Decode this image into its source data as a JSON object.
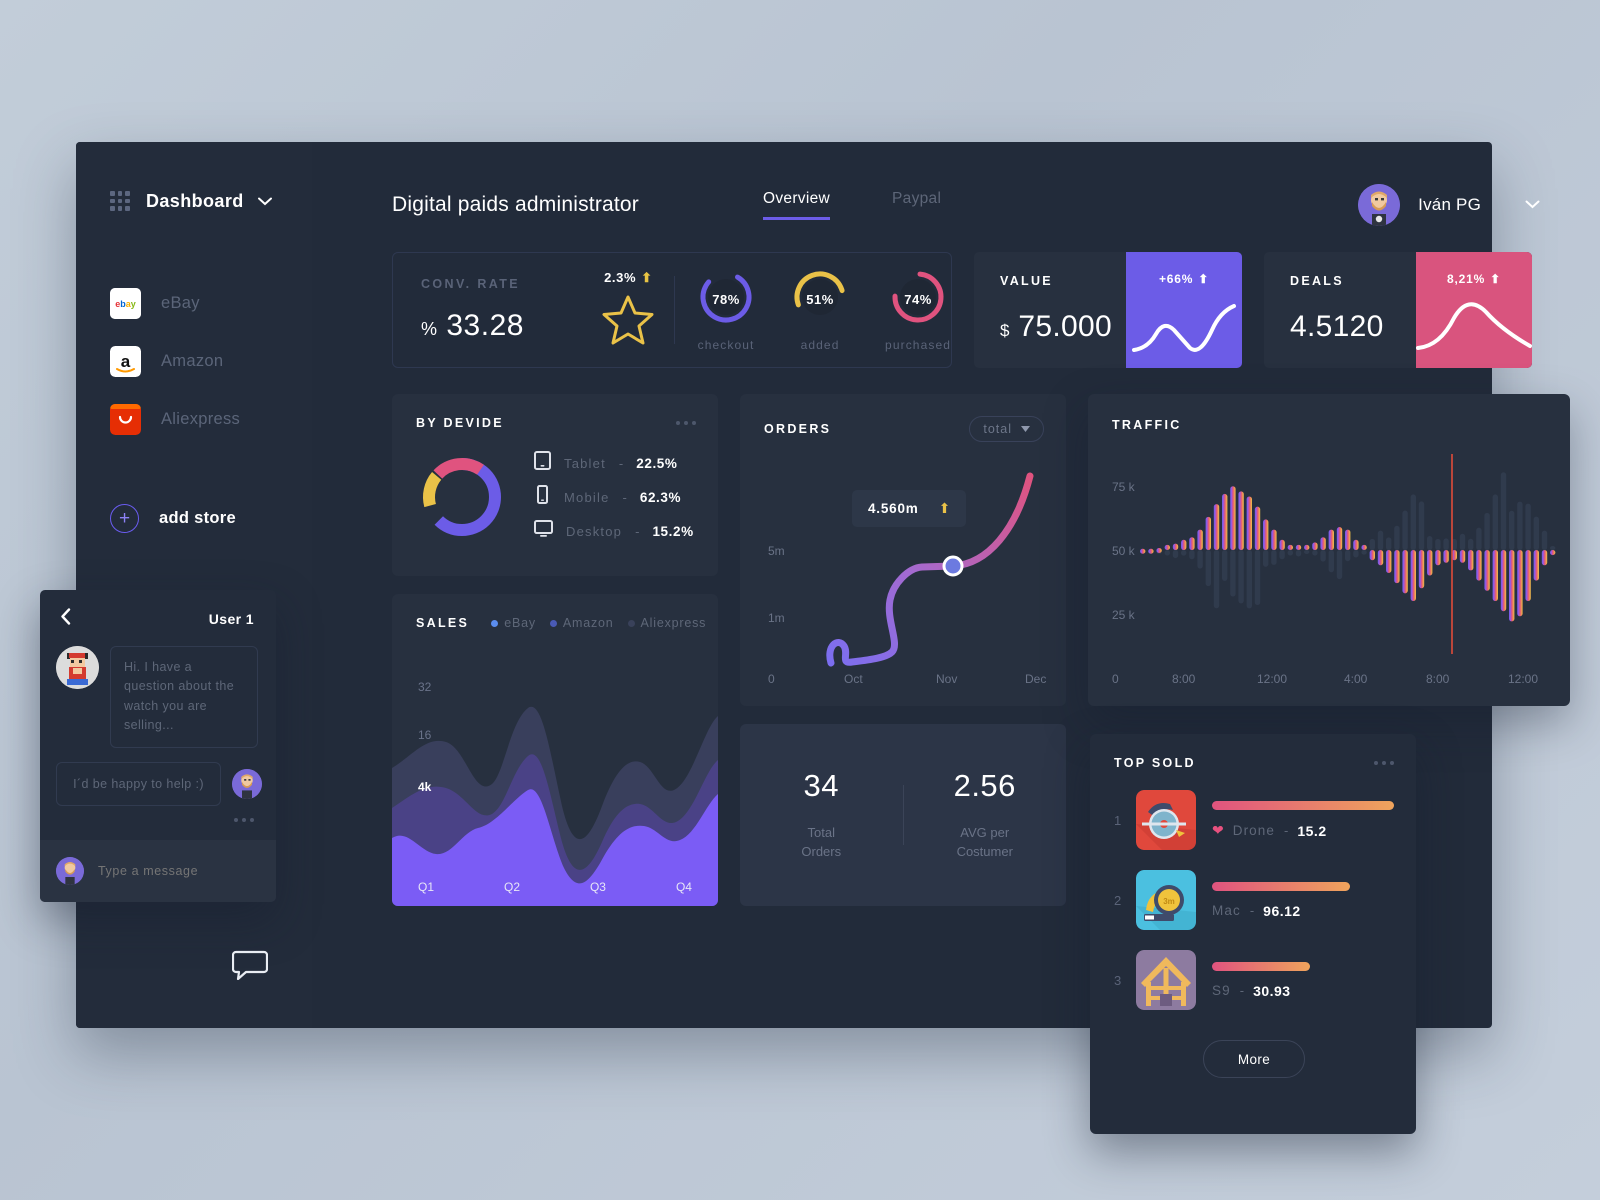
{
  "sidebar": {
    "dashboard_label": "Dashboard",
    "stores": [
      {
        "label": "eBay",
        "icon": "ebay-logo"
      },
      {
        "label": "Amazon",
        "icon": "amazon-logo"
      },
      {
        "label": "Aliexpress",
        "icon": "aliexpress-logo"
      }
    ],
    "add_store_label": "add store"
  },
  "header": {
    "title": "Digital paids administrator",
    "tabs": [
      {
        "label": "Overview",
        "active": true
      },
      {
        "label": "Paypal",
        "active": false
      }
    ],
    "user_name": "Iván PG"
  },
  "conv_card": {
    "label": "CONV. RATE",
    "currency": "%",
    "value": "33.28",
    "delta": "2.3%",
    "delta_dir": "up",
    "rings": [
      {
        "caption": "checkout",
        "pct": "78%",
        "value": 78,
        "color": "#6c5ce7"
      },
      {
        "caption": "added",
        "pct": "51%",
        "value": 51,
        "color": "#eac248"
      },
      {
        "caption": "purchased",
        "pct": "74%",
        "value": 74,
        "color": "#e0537f"
      }
    ]
  },
  "kpis": [
    {
      "label": "VALUE",
      "currency": "$",
      "value": "75.000",
      "badge": "+66%",
      "badge_dir": "up",
      "color": "#6c5ce7"
    },
    {
      "label": "DEALS",
      "currency": "",
      "value": "4.5120",
      "badge": "8,21%",
      "badge_dir": "up",
      "color": "#d9547e"
    }
  ],
  "by_device": {
    "title": "BY DEVIDE",
    "rows": [
      {
        "icon": "tablet-icon",
        "name": "Tablet",
        "value": "22.5%"
      },
      {
        "icon": "mobile-icon",
        "name": "Mobile",
        "value": "62.3%"
      },
      {
        "icon": "desktop-icon",
        "name": "Desktop",
        "value": "15.2%"
      }
    ]
  },
  "sales": {
    "title": "SALES",
    "legend": [
      {
        "label": "eBay",
        "color": "#5b8def"
      },
      {
        "label": "Amazon",
        "color": "#4a5ab5"
      },
      {
        "label": "Aliexpress",
        "color": "#39415a"
      }
    ],
    "y_labels": [
      "32",
      "16",
      "4k"
    ],
    "x_labels": [
      "Q1",
      "Q2",
      "Q3",
      "Q4"
    ]
  },
  "orders": {
    "title": "ORDERS",
    "selector": "total",
    "tooltip_value": "4.560m",
    "tooltip_dir": "up",
    "y_labels": [
      "5m",
      "1m",
      "0"
    ],
    "x_labels": [
      "Oct",
      "Nov",
      "Dec"
    ],
    "stats": [
      {
        "value": "34",
        "label": "Total Orders",
        "line1": "Total",
        "line2": "Orders"
      },
      {
        "value": "2.56",
        "label": "AVG per Costumer",
        "line1": "AVG per",
        "line2": "Costumer"
      }
    ]
  },
  "traffic": {
    "title": "TRAFFIC",
    "y_labels": [
      "75 k",
      "50 k",
      "25 k",
      "0"
    ],
    "x_labels": [
      "8:00",
      "12:00",
      "4:00",
      "8:00",
      "12:00"
    ]
  },
  "top_sold": {
    "title": "TOP SOLD",
    "items": [
      {
        "rank": "1",
        "name": "Drone",
        "value": "15.2",
        "bar": 100,
        "thumb": "circular-saw",
        "liked": true
      },
      {
        "rank": "2",
        "name": "Mac",
        "value": "96.12",
        "bar": 76,
        "thumb": "tape-measure",
        "liked": false
      },
      {
        "rank": "3",
        "name": "S9",
        "value": "30.93",
        "bar": 54,
        "thumb": "house-frame",
        "liked": false
      }
    ],
    "more_label": "More"
  },
  "chat": {
    "user": "User 1",
    "messages": [
      {
        "from": "them",
        "text": "Hi. I have a question about the watch you are selling..."
      },
      {
        "from": "me",
        "text": "I´d be happy to help :)"
      }
    ],
    "input_placeholder": "Type a message"
  },
  "chart_data": [
    {
      "type": "pie",
      "title": "BY DEVIDE",
      "categories": [
        "Mobile",
        "Tablet",
        "Desktop"
      ],
      "values": [
        62.3,
        22.5,
        15.2
      ],
      "colors": [
        "#6c5ce7",
        "#e0537f",
        "#eac248"
      ]
    },
    {
      "type": "area",
      "title": "SALES",
      "categories": [
        "Q1",
        "Q2",
        "Q3",
        "Q4"
      ],
      "ylabel": "",
      "xlabel": "",
      "ytick_labels": [
        "4k",
        "16",
        "32"
      ],
      "series": [
        {
          "name": "eBay",
          "color": "#7b5cf5",
          "values": [
            12,
            9,
            13,
            18,
            20,
            10,
            6,
            11,
            17,
            13,
            22,
            24
          ]
        },
        {
          "name": "Amazon",
          "color": "#4a4286",
          "values": [
            6,
            5,
            6,
            7,
            8,
            5,
            4,
            6,
            7,
            6,
            8,
            9
          ]
        },
        {
          "name": "Aliexpress",
          "color": "#393f5c",
          "values": [
            5,
            4,
            5,
            9,
            10,
            4,
            3,
            6,
            7,
            5,
            8,
            9
          ]
        }
      ]
    },
    {
      "type": "line",
      "title": "ORDERS",
      "x": [
        "0",
        "Oct",
        "Nov",
        "Dec"
      ],
      "ytick_labels": [
        "0",
        "1m",
        "5m"
      ],
      "highlight_point": {
        "x": "Nov",
        "label": "4.560m"
      },
      "series": [
        {
          "name": "total",
          "values": [
            0.4,
            0.8,
            0.5,
            0.6,
            4.6,
            4.7,
            8.5
          ]
        }
      ],
      "gradient": [
        "#7b6ef0",
        "#e0537f"
      ]
    },
    {
      "type": "bar",
      "title": "TRAFFIC",
      "ylabel": "",
      "ylim": [
        0,
        85
      ],
      "ytick_labels": [
        "0",
        "25 k",
        "50 k",
        "75 k"
      ],
      "xtick_labels": [
        "8:00",
        "12:00",
        "4:00",
        "8:00",
        "12:00"
      ],
      "baseline": 50,
      "values": [
        50.5,
        50.5,
        50.8,
        52,
        52.5,
        54,
        55,
        58,
        63,
        68,
        72,
        75,
        73,
        71,
        67,
        62,
        58,
        54,
        52,
        52,
        52,
        53,
        55,
        58,
        59,
        58,
        54,
        52,
        46,
        44,
        41,
        37,
        33,
        30,
        35,
        40,
        44,
        45,
        46,
        45,
        42,
        38,
        34,
        30,
        26,
        22,
        24,
        30,
        38,
        44,
        48
      ],
      "colors_gradient": [
        "#6c5ce7",
        "#a855d6",
        "#e0537f",
        "#ef8a5a",
        "#eac248"
      ],
      "marker_line_color": "#e04b3a"
    },
    {
      "type": "bar",
      "title": "TOP SOLD",
      "categories": [
        "Drone",
        "Mac",
        "S9"
      ],
      "values": [
        15.2,
        96.12,
        30.93
      ],
      "bar_lengths": [
        100,
        76,
        54
      ],
      "gradient": [
        "#e0537f",
        "#efa45c"
      ]
    }
  ]
}
